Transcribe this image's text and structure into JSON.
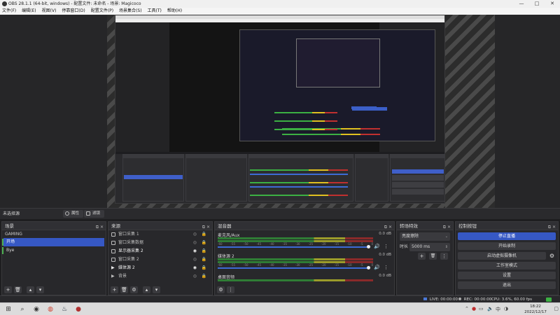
{
  "window": {
    "title": "OBS 28.1.1 (64-bit, windows) - 配置文件: 未命名 - 场景: Magicoco",
    "controls": [
      "—",
      "□",
      "✕"
    ]
  },
  "menubar": [
    "文件(F)",
    "编辑(E)",
    "视图(V)",
    "停靠窗口(D)",
    "配置文件(P)",
    "场景集合(S)",
    "工具(T)",
    "帮助(H)"
  ],
  "preview_bar": {
    "label": "未选择源",
    "properties_label": "属性",
    "filters_label": "滤镜"
  },
  "scenes": {
    "title": "场景",
    "collection": "GAMING",
    "items": [
      {
        "label": "开场",
        "active": true
      },
      {
        "label": "Bye",
        "active": false
      }
    ]
  },
  "sources": {
    "title": "来源",
    "items": [
      {
        "label": "窗口采集 1",
        "icon": "window-icon"
      },
      {
        "label": "窗口采集数据",
        "icon": "window-icon"
      },
      {
        "label": "显示器采集 2",
        "icon": "monitor-icon"
      },
      {
        "label": "窗口采集 2",
        "icon": "window-icon"
      },
      {
        "label": "媒体源 2",
        "icon": "play-icon"
      },
      {
        "label": "背景",
        "icon": "play-icon"
      }
    ]
  },
  "mixer": {
    "title": "混音器",
    "ticks": [
      "-60",
      "-55",
      "-50",
      "-45",
      "-40",
      "-35",
      "-30",
      "-25",
      "-20",
      "-15",
      "-10",
      "-5",
      "0"
    ],
    "channels": [
      {
        "name": "麦克风/Aux",
        "db": "0.0 dB"
      },
      {
        "name": "媒体源 2",
        "db": "0.0 dB"
      },
      {
        "name": "桌面音频",
        "db": "0.0 dB"
      }
    ]
  },
  "transitions": {
    "title": "转场特效",
    "selected": "亮度擦除",
    "duration_label": "时长",
    "duration_value": "5000 ms"
  },
  "controls": {
    "title": "控制按钮",
    "buttons": [
      "停止直播",
      "开始录制",
      "启动虚拟摄像机",
      "工作室模式",
      "设置",
      "退出"
    ]
  },
  "statusbar": {
    "live": "LIVE: 00:00:00",
    "rec": "REC: 00:00:00",
    "cpu": "CPU: 3.6%, 60.00 fps"
  },
  "taskbar": {
    "time": "18:22",
    "date": "2022/12/17"
  },
  "colors": {
    "accent": "#3658c4",
    "panel": "#28282b",
    "meter_green": "#2f7d35",
    "meter_yellow": "#9c9c2a",
    "meter_red": "#8a2a2a"
  }
}
